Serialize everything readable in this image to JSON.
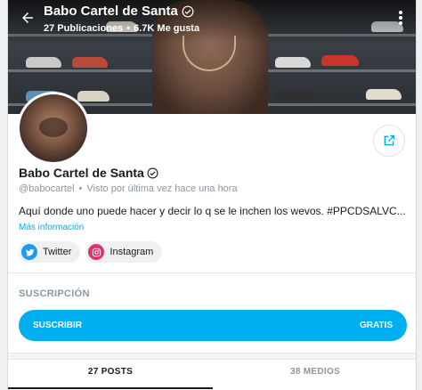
{
  "header": {
    "title": "Babo Cartel de Santa",
    "posts_count": "27 Publicaciones",
    "separator": "•",
    "likes_count": "6.7K Me gusta"
  },
  "profile": {
    "name": "Babo Cartel de Santa",
    "username": "@babocartel",
    "separator": "•",
    "last_seen": "Visto por última vez hace una hora",
    "bio": "Aquí donde uno puede hacer y decir lo q se le inchen los wevos. #PPCDSALVC...",
    "more_info": "Más información"
  },
  "socials": [
    {
      "label": "Twitter",
      "icon": "twitter-icon",
      "color": "#1d9bf0"
    },
    {
      "label": "Instagram",
      "icon": "instagram-icon",
      "color": "#e1306c"
    }
  ],
  "subscription": {
    "heading": "SUSCRIPCIÓN",
    "button_label": "SUSCRIBIR",
    "price": "GRATIS"
  },
  "tabs": [
    {
      "label": "27 POSTS",
      "active": true
    },
    {
      "label": "38 MEDIOS",
      "active": false
    }
  ],
  "colors": {
    "accent": "#00aff0",
    "muted": "#8a96a3"
  }
}
